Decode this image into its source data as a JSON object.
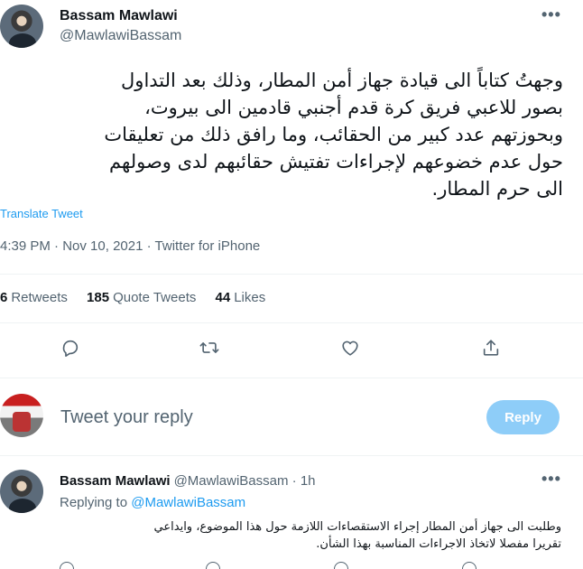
{
  "tweet": {
    "author_name": "Bassam Mawlawi",
    "author_handle": "@MawlawiBassam",
    "more_icon": "more-horizontal-icon",
    "text_lines": [
      "وجهتُ كتاباً الى قيادة جهاز أمن المطار، وذلك بعد التداول",
      "بصور للاعبي فريق كرة قدم أجنبي قادمين الى بيروت،",
      "وبحوزتهم عدد كبير من الحقائب، وما رافق ذلك من تعليقات",
      "حول عدم خضوعهم لإجراءات تفتيش حقائبهم لدى وصولهم",
      "الى حرم المطار."
    ],
    "translate_label": "Translate Tweet",
    "time": "4:39 PM",
    "separator": "·",
    "date": "Nov 10, 2021",
    "source": "Twitter for iPhone"
  },
  "stats": {
    "retweets_count": "6",
    "retweets_label": "Retweets",
    "quotes_count": "185",
    "quotes_label": "Quote Tweets",
    "likes_count": "44",
    "likes_label": "Likes"
  },
  "actions": [
    "reply-icon",
    "retweet-icon",
    "like-icon",
    "share-icon"
  ],
  "reply_box": {
    "placeholder": "Tweet your reply",
    "button_label": "Reply",
    "button_color": "#8ecdf8"
  },
  "reply": {
    "author_name": "Bassam Mawlawi",
    "author_handle": "@MawlawiBassam",
    "separator": "·",
    "time_ago": "1h",
    "replying_label": "Replying to",
    "replying_mention": "@MawlawiBassam",
    "text_lines": [
      "وطلبت الى جهاز أمن المطار إجراء الاستقصاءات اللازمة حول هذا الموضوع، وايداعي",
      "تقريرا مفصلا لاتخاذ الاجراءات المناسبة بهذا الشأن."
    ]
  },
  "colors": {
    "accent": "#1d9bf0",
    "text": "#0f1419",
    "secondary": "#536471",
    "divider": "#eff3f4"
  }
}
